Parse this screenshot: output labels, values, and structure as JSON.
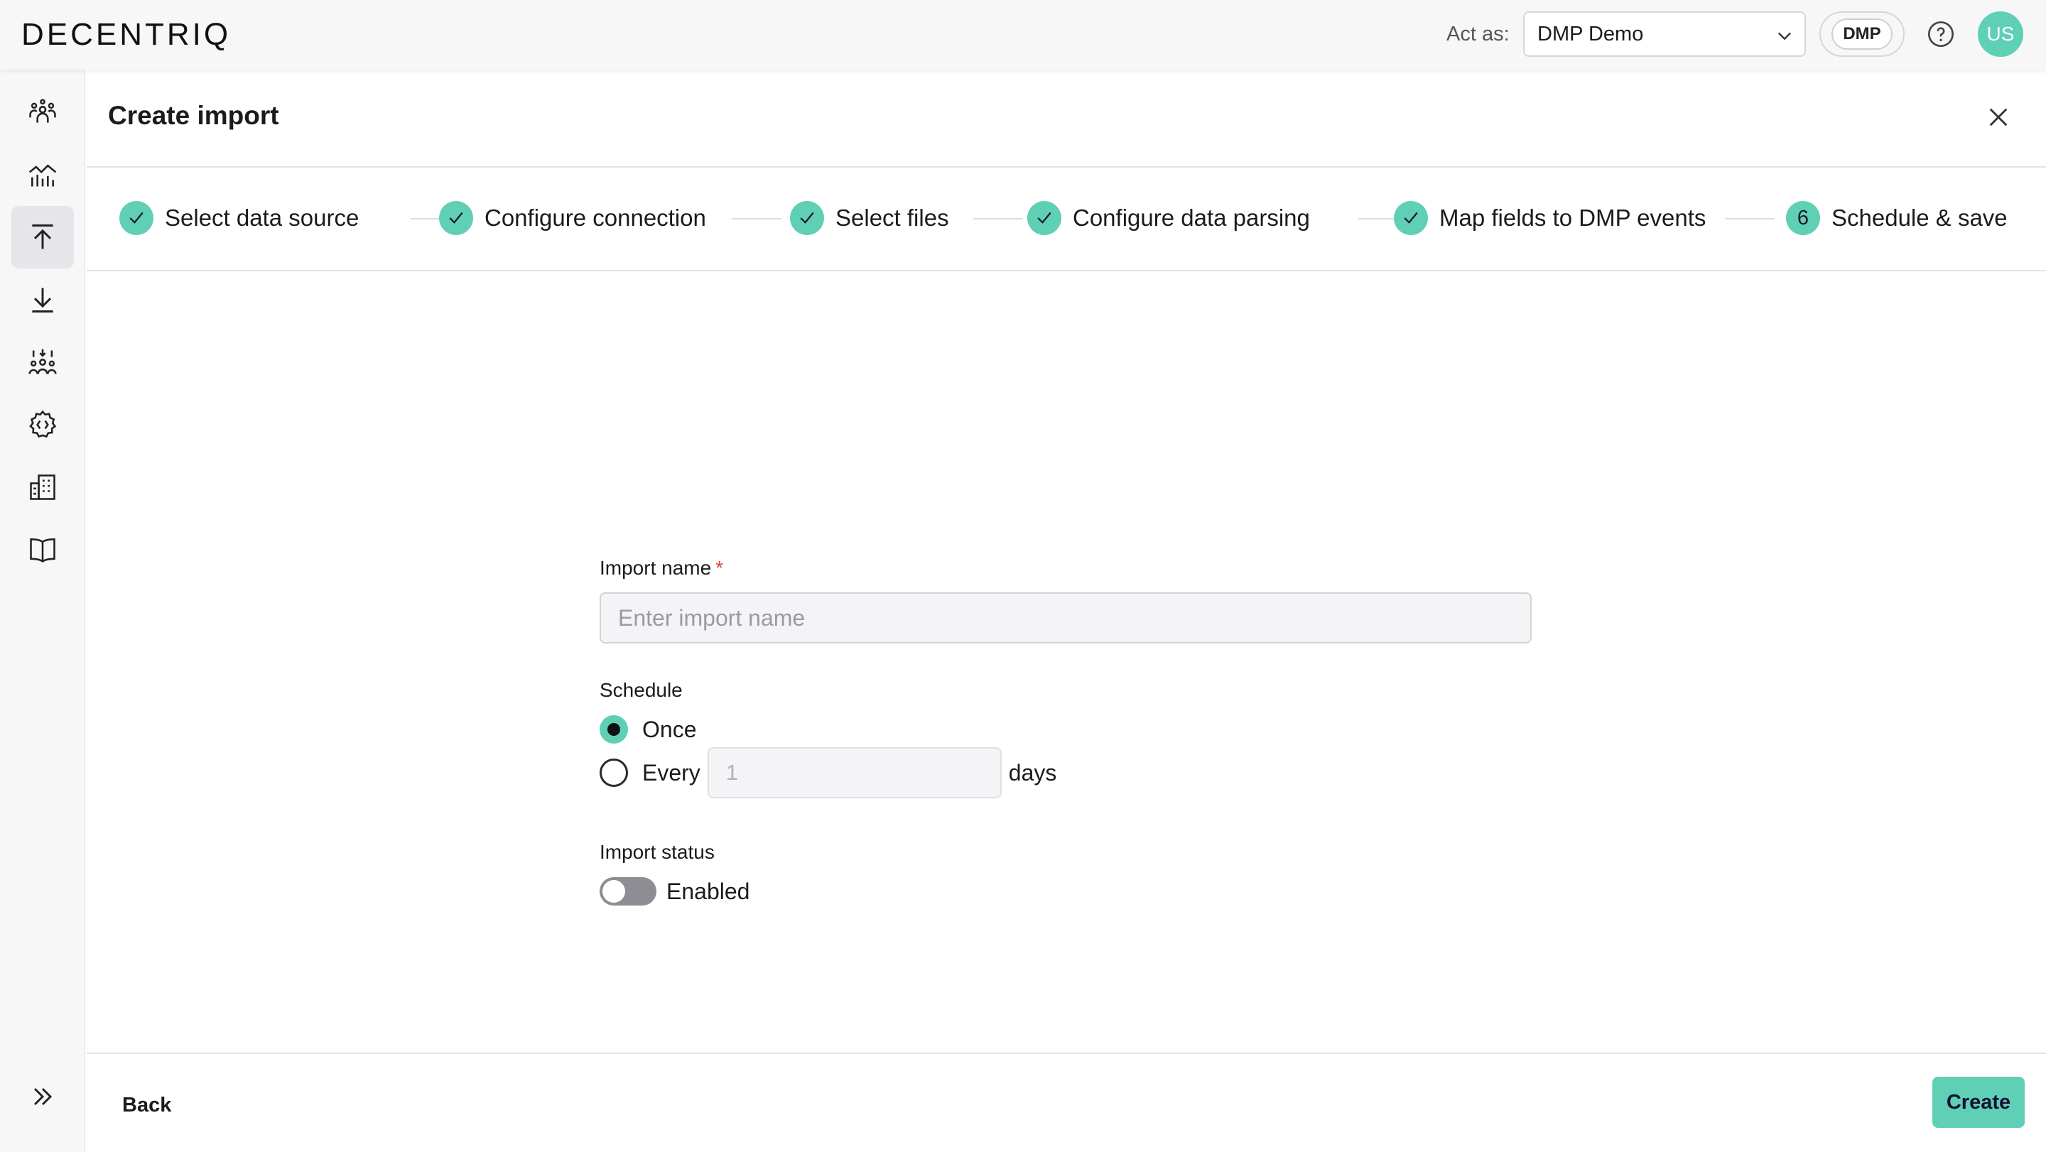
{
  "app": {
    "logo_text": "DECENTRIQ",
    "act_as_label": "Act as:",
    "act_as_value": "DMP Demo",
    "chip_label": "DMP",
    "avatar_initials": "US"
  },
  "sidebar": {
    "items": [
      {
        "icon": "people-icon",
        "active": false
      },
      {
        "icon": "insights-chart-icon",
        "active": false
      },
      {
        "icon": "upload-icon",
        "active": true
      },
      {
        "icon": "download-icon",
        "active": false
      },
      {
        "icon": "audience-icon",
        "active": false
      },
      {
        "icon": "gear-code-icon",
        "active": false
      },
      {
        "icon": "building-icon",
        "active": false
      },
      {
        "icon": "book-icon",
        "active": false
      }
    ],
    "expand_icon": "double-chevron-right-icon"
  },
  "page": {
    "title": "Create import"
  },
  "stepper": {
    "steps": [
      {
        "label": "Select data source",
        "status": "done"
      },
      {
        "label": "Configure connection",
        "status": "done"
      },
      {
        "label": "Select files",
        "status": "done"
      },
      {
        "label": "Configure data parsing",
        "status": "done"
      },
      {
        "label": "Map fields to DMP events",
        "status": "done"
      },
      {
        "label": "Schedule & save",
        "status": "current",
        "number": "6"
      }
    ]
  },
  "form": {
    "import_name_label": "Import name",
    "required_marker": "*",
    "import_name_placeholder": "Enter import name",
    "schedule_label": "Schedule",
    "schedule_options": [
      {
        "label": "Once",
        "selected": true
      },
      {
        "label": "Every",
        "selected": false
      }
    ],
    "every_value_placeholder": "1",
    "every_unit": "days",
    "status_label": "Import status",
    "status_toggle_label": "Enabled",
    "status_enabled": false
  },
  "footer": {
    "back_label": "Back",
    "create_label": "Create"
  },
  "colors": {
    "accent": "#5fcfb6",
    "required": "#e0443b"
  }
}
